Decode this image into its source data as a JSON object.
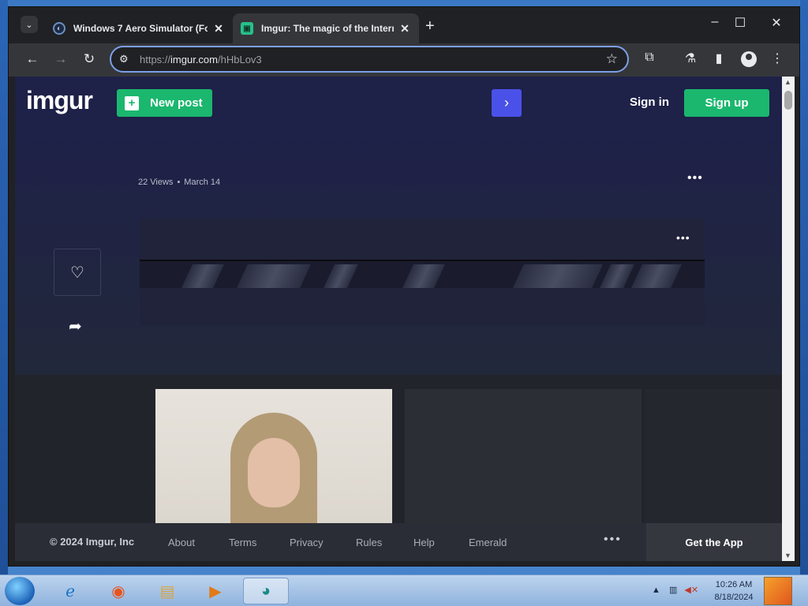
{
  "browser": {
    "tabs": [
      {
        "title": "Windows 7 Aero Simulator (Fo",
        "active": false
      },
      {
        "title": "Imgur: The magic of the Intern",
        "active": true
      }
    ],
    "address": {
      "scheme": "https://",
      "host": "imgur.com",
      "path": "/hHbLov3"
    },
    "window_controls": {
      "minimize": "–",
      "maximize": "☐",
      "close": "✕"
    }
  },
  "imgur": {
    "logo": "imgur",
    "new_post": "New post",
    "next_arrow": "›",
    "sign_in": "Sign in",
    "sign_up": "Sign up",
    "post": {
      "views": "22 Views",
      "separator": "•",
      "date": "March 14",
      "more": "•••"
    },
    "footer": {
      "copyright": "© 2024 Imgur, Inc",
      "links": [
        "About",
        "Terms",
        "Privacy",
        "Rules",
        "Help",
        "Emerald"
      ],
      "more": "•••",
      "get_app": "Get the App"
    }
  },
  "taskbar": {
    "time": "10:26 AM",
    "date": "8/18/2024"
  },
  "icons": {
    "heart": "♡",
    "share": "➦",
    "plus": "+",
    "star": "☆"
  }
}
